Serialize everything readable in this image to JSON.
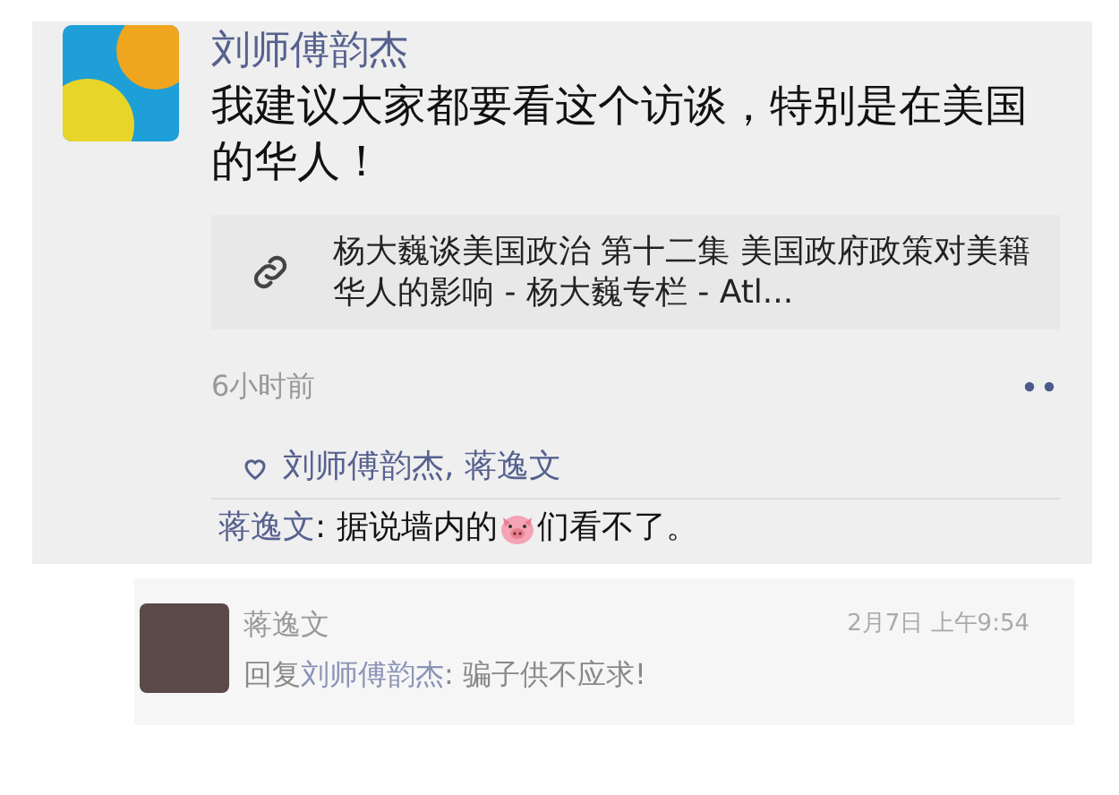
{
  "post": {
    "author": "刘师傅韵杰",
    "text": "我建议大家都要看这个访谈，特别是在美国的华人！",
    "link": {
      "title": "杨大巍谈美国政治 第十二集 美国政府政策对美籍华人的影响 - 杨大巍专栏 - Atl..."
    },
    "time": "6小时前",
    "likes": [
      "刘师傅韵杰",
      "蒋逸文"
    ],
    "likes_separator": ",",
    "comments": [
      {
        "author": "蒋逸文",
        "text_before": ": 据说墙内的",
        "text_after": "们看不了。"
      }
    ]
  },
  "reply": {
    "author": "蒋逸文",
    "date": "2月7日 上午9:54",
    "prefix": "回复",
    "to": "刘师傅韵杰",
    "text": ": 骗子供不应求!"
  }
}
